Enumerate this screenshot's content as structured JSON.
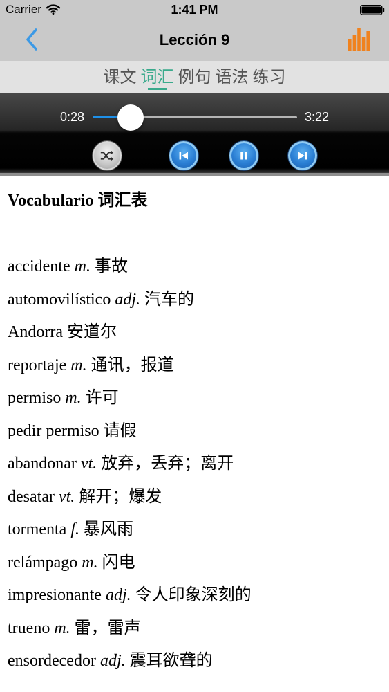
{
  "status_bar": {
    "carrier": "Carrier",
    "time": "1:41 PM",
    "wifi_icon": "wifi-icon",
    "battery_icon": "battery-icon"
  },
  "nav": {
    "title": "Lección 9",
    "back_icon": "chevron-left-icon",
    "right_icon": "bar-chart-icon"
  },
  "tabs": [
    {
      "label": "课文"
    },
    {
      "label": "词汇",
      "selected": true
    },
    {
      "label": "例句"
    },
    {
      "label": "语法"
    },
    {
      "label": "练习"
    }
  ],
  "player": {
    "elapsed": "0:28",
    "duration": "3:22",
    "progress": 0.139,
    "controls": [
      {
        "icon": "shuffle-icon"
      },
      {
        "icon": "skip-previous-icon"
      },
      {
        "icon": "pause-icon"
      },
      {
        "icon": "skip-next-icon"
      }
    ]
  },
  "content": {
    "heading": "Vocabulario 词汇表",
    "entries": [
      {
        "word": "accidente",
        "pos": "m.",
        "meaning": "事故"
      },
      {
        "word": "automovilístico",
        "pos": "adj.",
        "meaning": "汽车的"
      },
      {
        "word": "Andorra",
        "meaning": "安道尔"
      },
      {
        "word": "reportaje",
        "pos": "m.",
        "meaning": "通讯，报道"
      },
      {
        "word": "permiso",
        "pos": "m.",
        "meaning": "许可"
      },
      {
        "word": "pedir permiso",
        "meaning": "请假"
      },
      {
        "word": "abandonar",
        "pos": "vt.",
        "meaning": "放弃，丢弃；离开"
      },
      {
        "word": "desatar",
        "pos": "vt.",
        "meaning": "解开；爆发"
      },
      {
        "word": "tormenta",
        "pos": "f.",
        "meaning": "暴风雨"
      },
      {
        "word": "relámpago",
        "pos": "m.",
        "meaning": "闪电"
      },
      {
        "word": "impresionante",
        "pos": "adj.",
        "meaning": "令人印象深刻的"
      },
      {
        "word": "trueno",
        "pos": "m.",
        "meaning": "雷，雷声"
      },
      {
        "word": "ensordecedor",
        "pos": "adj.",
        "meaning": "震耳欲聋的"
      }
    ]
  },
  "colors": {
    "accent": "#3aaa8c",
    "tint": "#3b99e6",
    "orange": "#f0821e",
    "progress": "#1e90e8"
  }
}
